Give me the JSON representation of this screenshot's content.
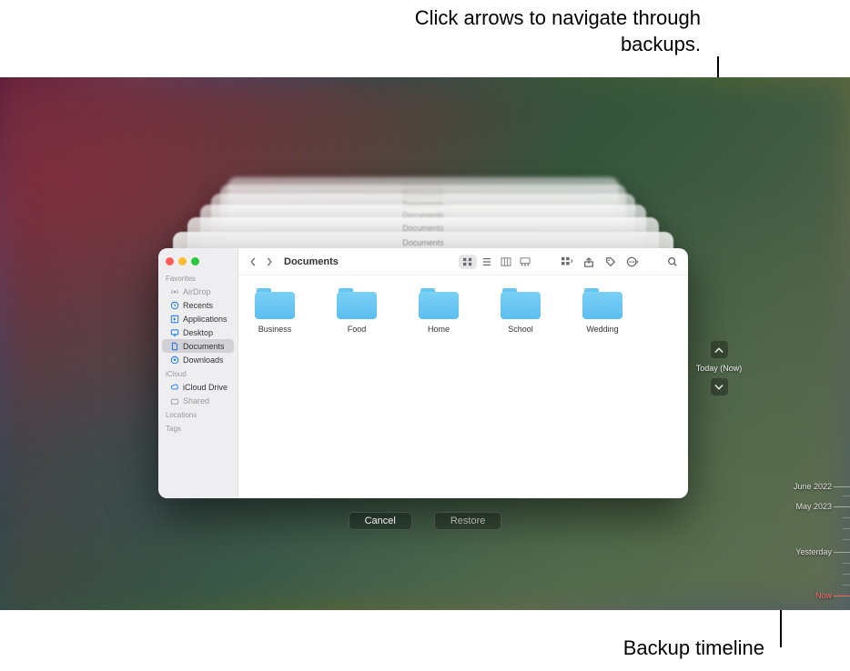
{
  "annotations": {
    "top": "Click arrows to navigate through backups.",
    "bottom": "Backup timeline"
  },
  "window": {
    "title": "Documents"
  },
  "sidebar": {
    "sections": {
      "favorites": "Favorites",
      "icloud": "iCloud",
      "locations": "Locations",
      "tags": "Tags"
    },
    "items": {
      "airdrop": "AirDrop",
      "recents": "Recents",
      "applications": "Applications",
      "desktop": "Desktop",
      "documents": "Documents",
      "downloads": "Downloads",
      "icloud_drive": "iCloud Drive",
      "shared": "Shared"
    }
  },
  "folders": [
    "Business",
    "Food",
    "Home",
    "School",
    "Wedding"
  ],
  "buttons": {
    "cancel": "Cancel",
    "restore": "Restore"
  },
  "nav": {
    "current": "Today (Now)"
  },
  "timeline": {
    "t0": "June 2022",
    "t1": "May 2023",
    "t2": "Yesterday",
    "t3": "Now"
  }
}
